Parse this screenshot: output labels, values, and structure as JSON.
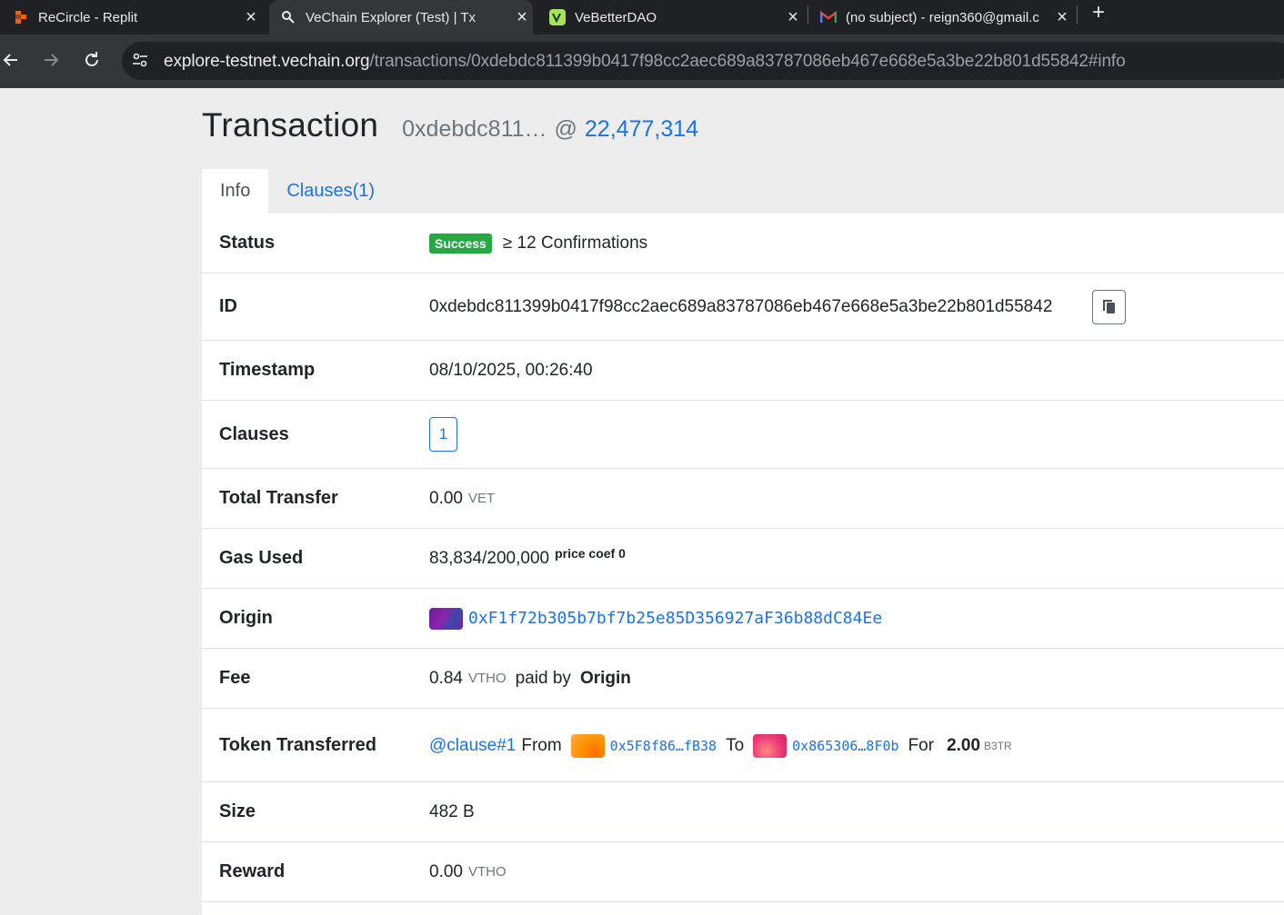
{
  "browser": {
    "tabs": [
      {
        "title": "ReCircle - Replit",
        "icon": "replit-icon"
      },
      {
        "title": "VeChain Explorer (Test) | Tx",
        "icon": "explorer-icon"
      },
      {
        "title": "VeBetterDAO",
        "icon": "vebetterdao-icon"
      },
      {
        "title": "(no subject) - reign360@gmail.c",
        "icon": "gmail-icon"
      }
    ],
    "url_host": "explore-testnet.vechain.org",
    "url_path": "/transactions/0xdebdc811399b0417f98cc2aec689a83787086eb467e668e5a3be22b801d55842#info"
  },
  "header": {
    "title": "Transaction",
    "tx_short": "0xdebdc811…",
    "at": "@",
    "block": "22,477,314"
  },
  "tabs": {
    "info": "Info",
    "clauses": "Clauses(1)"
  },
  "details": {
    "status": {
      "label": "Status",
      "badge": "Success",
      "confirmations": "≥ 12 Confirmations"
    },
    "id": {
      "label": "ID",
      "value": "0xdebdc811399b0417f98cc2aec689a83787086eb467e668e5a3be22b801d55842"
    },
    "timestamp": {
      "label": "Timestamp",
      "value": "08/10/2025, 00:26:40"
    },
    "clauses": {
      "label": "Clauses",
      "value": "1"
    },
    "total_transfer": {
      "label": "Total Transfer",
      "value": "0.00",
      "unit": "VET"
    },
    "gas_used": {
      "label": "Gas Used",
      "value": "83,834/200,000",
      "note": "price coef 0"
    },
    "origin": {
      "label": "Origin",
      "address": "0xF1f72b305b7bf7b25e85D356927aF36b88dC84Ee"
    },
    "fee": {
      "label": "Fee",
      "value": "0.84",
      "unit": "VTHO",
      "paid_by": "paid by",
      "payer": "Origin"
    },
    "token_transferred": {
      "label": "Token Transferred",
      "clause": "@clause#1",
      "from_label": "From",
      "from": "0x5F8f86…fB38",
      "to_label": "To",
      "to": "0x865306…8F0b",
      "for_label": "For",
      "amount": "2.00",
      "token": "B3TR"
    },
    "size": {
      "label": "Size",
      "value": "482 B"
    },
    "reward": {
      "label": "Reward",
      "value": "0.00",
      "unit": "VTHO"
    }
  },
  "colors": {
    "accent": "#1a73e8",
    "success": "#28a745",
    "chrome_dark": "#202124",
    "chrome": "#35363a"
  }
}
